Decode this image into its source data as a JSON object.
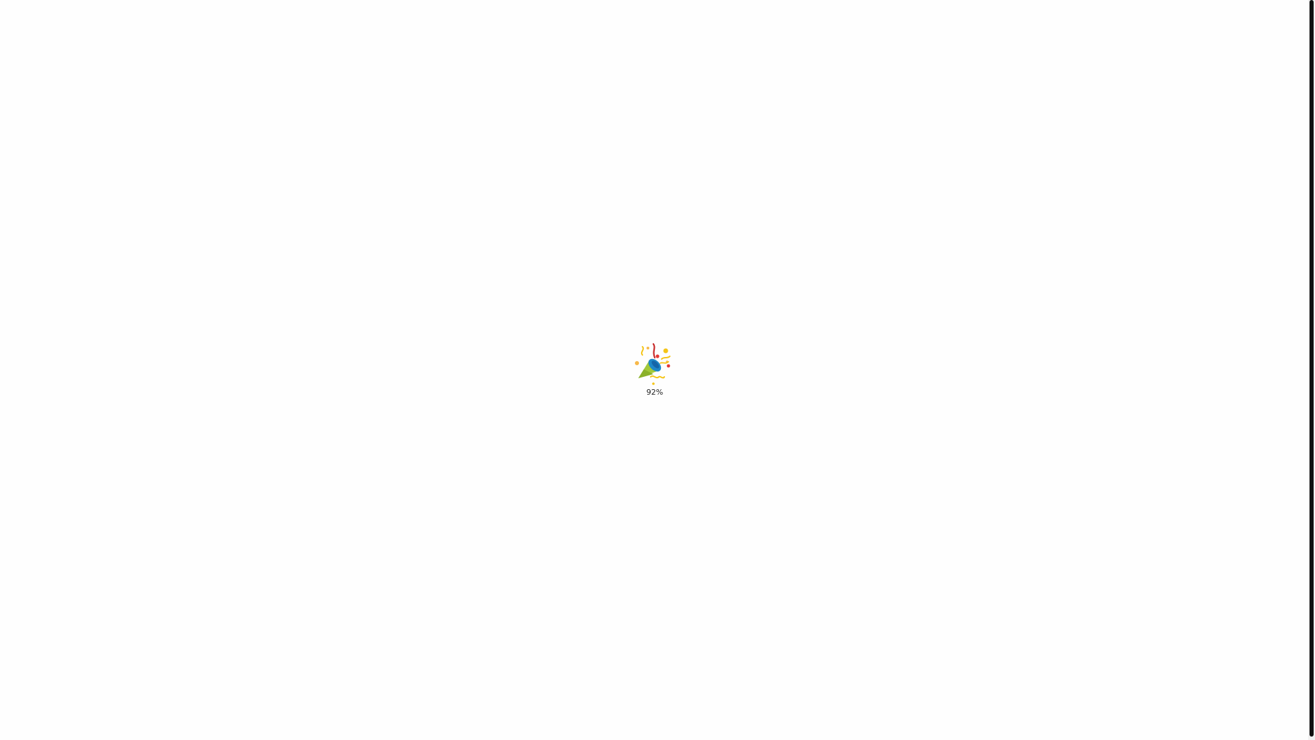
{
  "loader": {
    "icon": "party-popper-icon",
    "progress_text": "92%",
    "progress": 0.92
  },
  "colors": {
    "background": "#fefefe",
    "scrollbar_thumb": "#111111"
  }
}
